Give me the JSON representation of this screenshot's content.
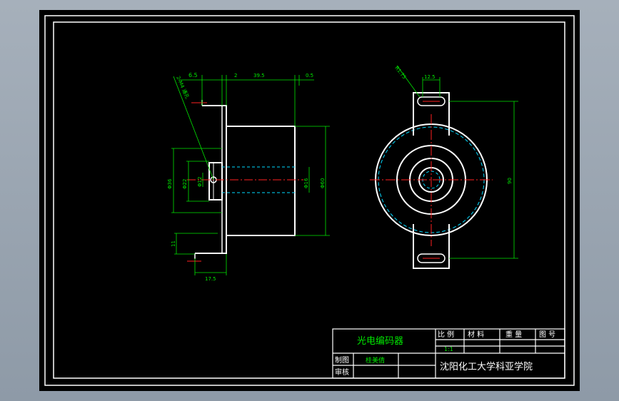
{
  "drawing": {
    "dims_left": {
      "top_offset": "6.5",
      "gap": "2",
      "body_length": "39.5",
      "end_gap": "0.5",
      "dia_outer": "Φ36",
      "dia_mid": "Φ22",
      "dia_inner": "Φ12",
      "dia_bore": "Φ16",
      "dia_body": "Φ60",
      "flange_thick": "11",
      "flange_width": "17.5",
      "hole_note": "2-M4 通孔"
    },
    "dims_right": {
      "slot_radius": "R1.75",
      "slot_width": "12.5",
      "height": "90"
    }
  },
  "title_block": {
    "part_name": "光电编码器",
    "scale_label": "比 例",
    "scale_value": "1:1",
    "material_label": "材 料",
    "weight_label": "重 量",
    "drawing_no_label": "图 号",
    "drawn_label": "制图",
    "drawn_by": "桂美倩",
    "checked_label": "审核",
    "school": "沈阳化工大学科亚学院"
  },
  "colors": {
    "outline": "#ffffff",
    "dimension": "#00e600",
    "center": "#ff2020",
    "hidden": "#00d8ff"
  }
}
